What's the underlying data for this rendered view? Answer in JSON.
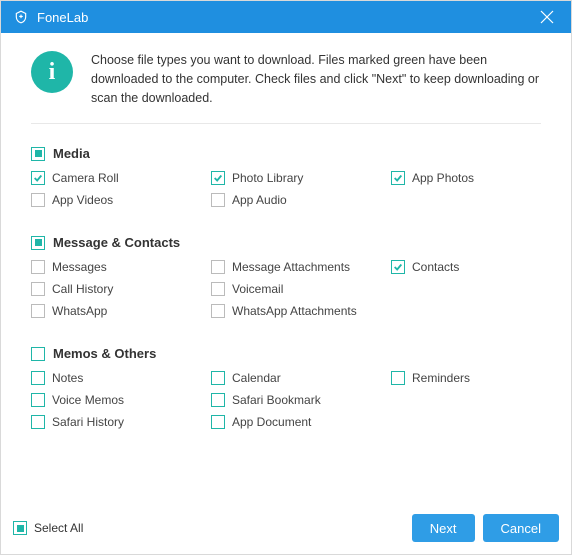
{
  "titlebar": {
    "title": "FoneLab"
  },
  "info": {
    "text": "Choose file types you want to download. Files marked green have been downloaded to the computer. Check files and click \"Next\" to keep downloading or scan the downloaded."
  },
  "sections": [
    {
      "title": "Media",
      "state": "partial",
      "items": [
        {
          "label": "Camera Roll",
          "checked": true
        },
        {
          "label": "Photo Library",
          "checked": true
        },
        {
          "label": "App Photos",
          "checked": true
        },
        {
          "label": "App Videos",
          "checked": false
        },
        {
          "label": "App Audio",
          "checked": false
        }
      ]
    },
    {
      "title": "Message & Contacts",
      "state": "partial",
      "items": [
        {
          "label": "Messages",
          "checked": false
        },
        {
          "label": "Message Attachments",
          "checked": false
        },
        {
          "label": "Contacts",
          "checked": true
        },
        {
          "label": "Call History",
          "checked": false
        },
        {
          "label": "Voicemail",
          "checked": false
        },
        {
          "label": "WhatsApp",
          "checked": false
        },
        {
          "label": "WhatsApp Attachments",
          "checked": false
        }
      ]
    },
    {
      "title": "Memos & Others",
      "state": "unchecked",
      "items": [
        {
          "label": "Notes",
          "checked": false
        },
        {
          "label": "Calendar",
          "checked": false
        },
        {
          "label": "Reminders",
          "checked": false
        },
        {
          "label": "Voice Memos",
          "checked": false
        },
        {
          "label": "Safari Bookmark",
          "checked": false
        },
        {
          "label": "Safari History",
          "checked": false
        },
        {
          "label": "App Document",
          "checked": false
        }
      ]
    }
  ],
  "footer": {
    "select_all": "Select All",
    "select_all_state": "partial",
    "next": "Next",
    "cancel": "Cancel"
  },
  "colors": {
    "accent": "#1f8fe0",
    "teal": "#1fb6a8",
    "btn": "#2f9de6"
  }
}
